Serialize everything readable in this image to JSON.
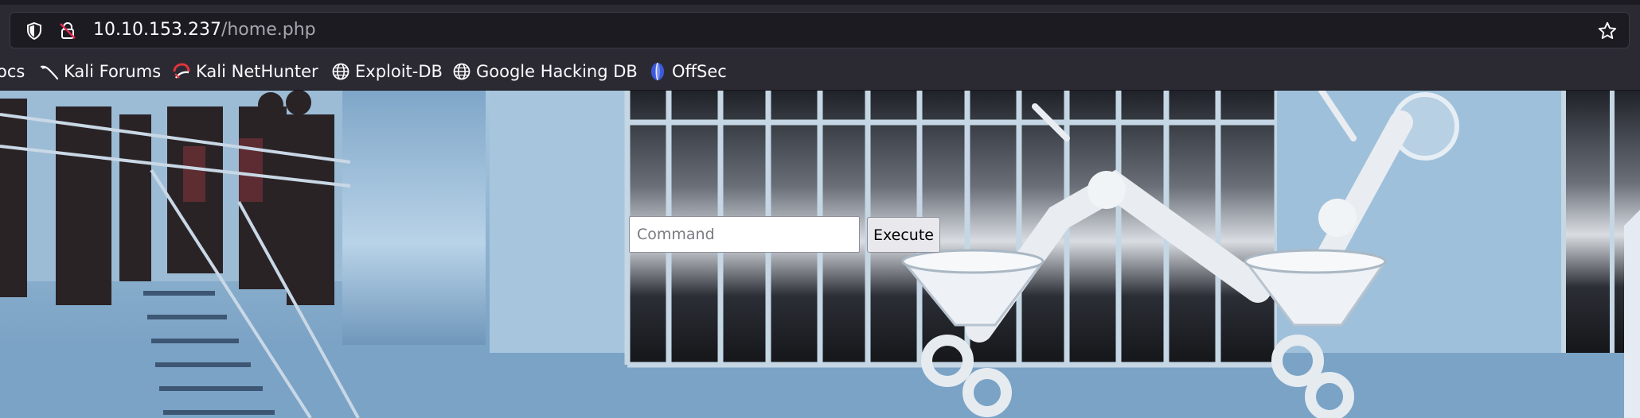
{
  "browser": {
    "url_host": "10.10.153.237",
    "url_path": "/home.php",
    "icons": {
      "shield": "shield-icon",
      "lock": "lock-warning-icon",
      "star": "star-icon"
    }
  },
  "bookmarks": [
    {
      "label": "ocs",
      "icon": "none"
    },
    {
      "label": "Kali Forums",
      "icon": "kali-dragon-icon"
    },
    {
      "label": "Kali NetHunter",
      "icon": "nethunter-icon"
    },
    {
      "label": "Exploit-DB",
      "icon": "globe-icon"
    },
    {
      "label": "Google Hacking DB",
      "icon": "globe-icon"
    },
    {
      "label": "OffSec",
      "icon": "offsec-icon"
    }
  ],
  "page": {
    "command_placeholder": "Command",
    "command_value": "",
    "execute_label": "Execute"
  },
  "colors": {
    "browser_chrome": "#2b2a33",
    "url_field": "#1c1b22",
    "page_background": "#8fb3cf"
  }
}
